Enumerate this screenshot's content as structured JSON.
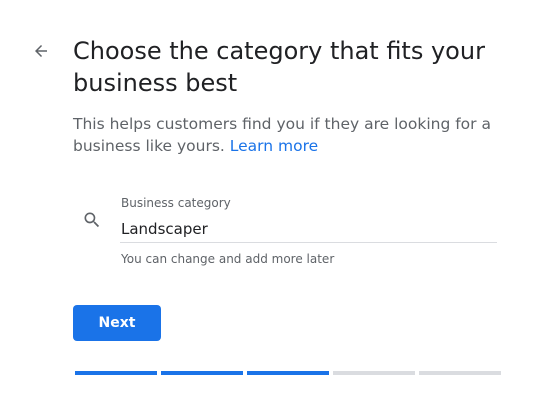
{
  "header": {
    "back_icon": "arrow-back-icon",
    "title": "Choose the category that fits your business best"
  },
  "intro": {
    "text": "This helps customers find you if they are looking for a business like yours.",
    "link_label": "Learn more"
  },
  "category_field": {
    "icon": "search-icon",
    "label": "Business category",
    "value": "Landscaper",
    "helper": "You can change and add more later"
  },
  "actions": {
    "next_label": "Next"
  },
  "progress": {
    "total_steps": 5,
    "completed_steps": 3
  },
  "colors": {
    "accent": "#1a73e8",
    "inactive": "#dadce0",
    "text_primary": "#202124",
    "text_secondary": "#5f6368"
  }
}
